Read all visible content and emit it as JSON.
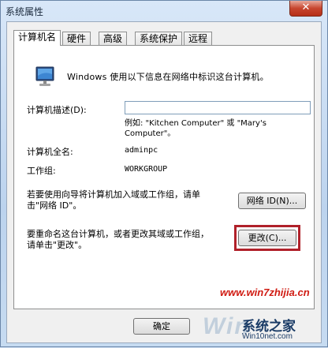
{
  "window": {
    "title": "系统属性",
    "close_glyph": "✕"
  },
  "tabs": [
    {
      "label": "计算机名",
      "active": true
    },
    {
      "label": "硬件",
      "active": false
    },
    {
      "label": "高级",
      "active": false
    },
    {
      "label": "系统保护",
      "active": false
    },
    {
      "label": "远程",
      "active": false
    }
  ],
  "content": {
    "monitor_icon": "computer-monitor-icon",
    "intro": "Windows 使用以下信息在网络中标识这台计算机。",
    "description_label": "计算机描述(D):",
    "description_value": "",
    "example_line1": "例如: \"Kitchen Computer\" 或 \"Mary's",
    "example_line2": "Computer\"。",
    "fullname_label": "计算机全名:",
    "fullname_value": "adminpc",
    "workgroup_label": "工作组:",
    "workgroup_value": "WORKGROUP",
    "network_text_line1": "若要使用向导将计算机加入域或工作组，请单",
    "network_text_line2": "击\"网络 ID\"。",
    "network_id_button": "网络 ID(N)...",
    "rename_text_line1": "要重命名这台计算机，或者更改其域或工作组，",
    "rename_text_line2": "请单击\"更改\"。",
    "change_button": "更改(C)..."
  },
  "footer": {
    "ok_button": "确定"
  },
  "watermark": {
    "site": "www.win7zhijia.cn",
    "logo_text": "Win",
    "brand_cn": "系统之家",
    "brand_url": "Win10net.com"
  },
  "colors": {
    "highlight_border": "#b0212a",
    "watermark_red": "#d01b12"
  }
}
